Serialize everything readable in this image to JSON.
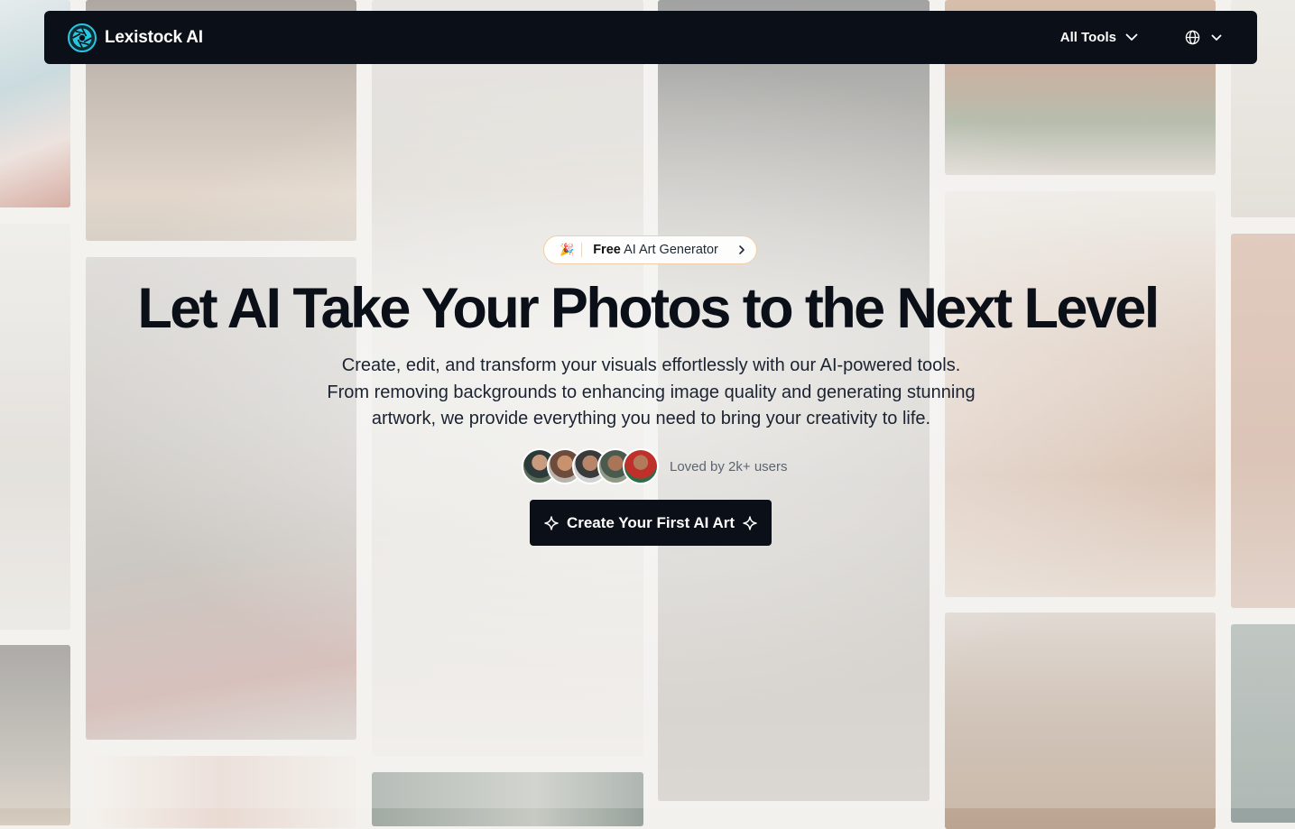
{
  "brand": {
    "name": "Lexistock AI",
    "logo_icon": "aperture-logo-icon",
    "accent": "#28c7e0"
  },
  "nav": {
    "tools_label": "All Tools",
    "tools_icon": "chevron-down-icon",
    "language_icon": "globe-icon",
    "language_chevron": "chevron-down-icon"
  },
  "hero": {
    "badge": {
      "icon": "party-popper-icon",
      "emphasis": "Free",
      "label": "AI Art Generator",
      "chevron": "chevron-right-icon"
    },
    "headline": "Let AI Take Your Photos to the Next Level",
    "subtext": [
      "Create, edit, and transform your visuals effortlessly with our AI-powered tools.",
      "From removing backgrounds to enhancing image quality and generating stunning",
      "artwork, we provide everything you need to bring your creativity to life."
    ],
    "social_proof": {
      "text": "Loved by 2k+ users",
      "avatar_count": 5
    },
    "cta": {
      "label": "Create Your First AI Art",
      "icon": "sparkle-icon"
    }
  },
  "colors": {
    "navbar_bg": "#0b0f17",
    "text_primary": "#0b0f17",
    "badge_border": "#f1cfa6"
  }
}
